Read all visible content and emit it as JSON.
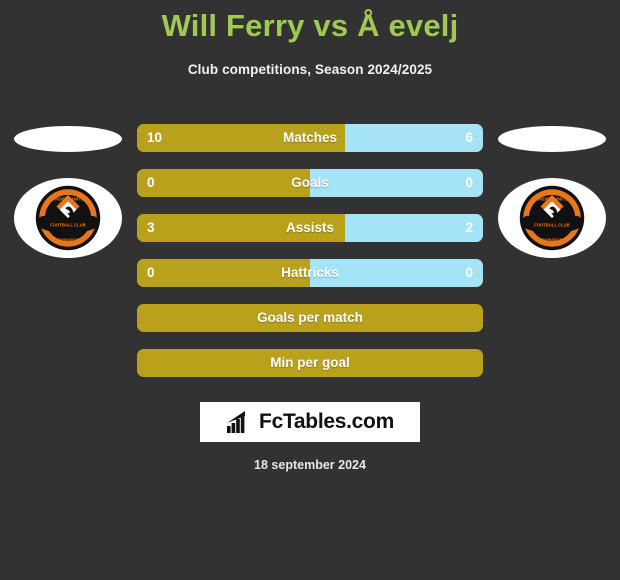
{
  "header": {
    "title": "Will Ferry vs Å evelj",
    "subtitle": "Club competitions, Season 2024/2025",
    "title_color": "#9ecb4f"
  },
  "teams": {
    "left": {
      "crest_name": "dundee-united-crest",
      "photo_name": "player-photo-left"
    },
    "right": {
      "crest_name": "dundee-united-crest",
      "photo_name": "player-photo-right"
    }
  },
  "colors": {
    "background": "#323232",
    "home_bar": "#b9a11b",
    "away_bar": "#a5e4f7",
    "text": "#ffffff"
  },
  "stats": [
    {
      "label": "Matches",
      "home": "10",
      "away": "6",
      "home_pct": 60,
      "split": true
    },
    {
      "label": "Goals",
      "home": "0",
      "away": "0",
      "home_pct": 50,
      "split": true
    },
    {
      "label": "Assists",
      "home": "3",
      "away": "2",
      "home_pct": 60,
      "split": true
    },
    {
      "label": "Hattricks",
      "home": "0",
      "away": "0",
      "home_pct": 50,
      "split": true
    },
    {
      "label": "Goals per match",
      "home": "",
      "away": "",
      "home_pct": 100,
      "split": false
    },
    {
      "label": "Min per goal",
      "home": "",
      "away": "",
      "home_pct": 100,
      "split": false
    }
  ],
  "logo": {
    "text": "FcTables.com",
    "icon_name": "bar-chart-arrow-icon"
  },
  "footer": {
    "date": "18 september 2024"
  }
}
